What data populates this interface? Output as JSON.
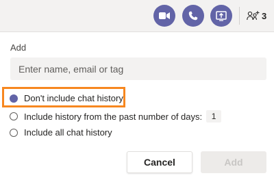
{
  "toolbar": {
    "video_icon": "video-camera-icon",
    "call_icon": "phone-icon",
    "share_icon": "share-screen-icon",
    "participants_icon": "people-add-icon",
    "participants_count": "3",
    "button_color": "#6264a7"
  },
  "form": {
    "label": "Add",
    "input_placeholder": "Enter name, email or tag",
    "options": [
      {
        "label": "Don't include chat history",
        "checked": true
      },
      {
        "label": "Include history from the past number of days:",
        "checked": false,
        "days": "1"
      },
      {
        "label": "Include all chat history",
        "checked": false
      }
    ],
    "highlight_color": "#f7871f"
  },
  "buttons": {
    "cancel": "Cancel",
    "add": "Add"
  }
}
